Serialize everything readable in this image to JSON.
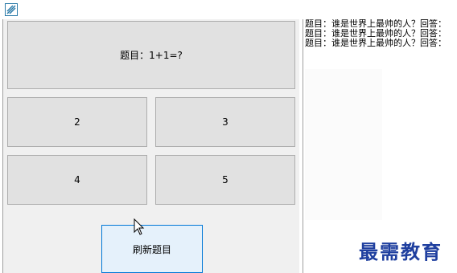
{
  "question_button": "题目：1+1=?",
  "options": [
    "2",
    "3",
    "4",
    "5"
  ],
  "refresh_button": "刷新题目",
  "log_lines": [
    "题目：谁是世界上最帅的人？回答：",
    "题目：谁是世界上最帅的人？回答：",
    "题目：谁是世界上最帅的人？回答："
  ],
  "watermark": "最需教育",
  "colors": {
    "button_bg": "#e1e1e1",
    "focused_button_border": "#0078d7",
    "watermark": "#1f3f9f"
  }
}
